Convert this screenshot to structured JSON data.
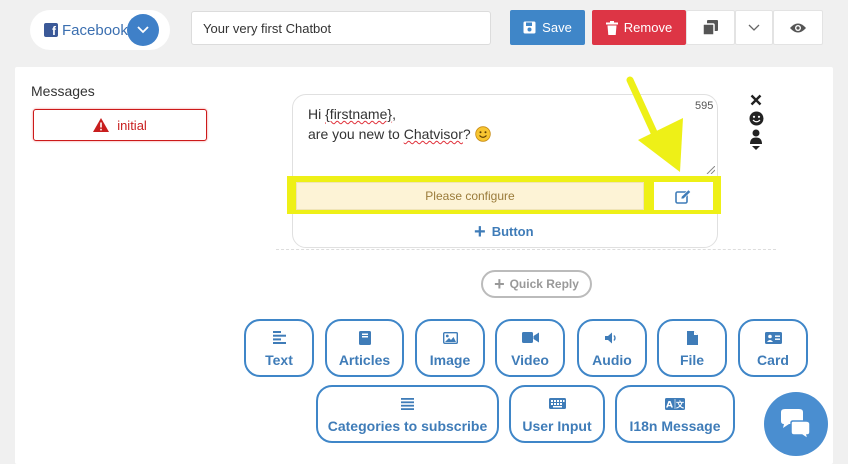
{
  "toolbar": {
    "platform_label": "Facebook",
    "title_value": "Your very first Chatbot",
    "save_label": "Save",
    "remove_label": "Remove"
  },
  "messages": {
    "heading": "Messages",
    "initial_label": "initial"
  },
  "message_card": {
    "line1_prefix": "Hi ",
    "line1_var": "{firstname}",
    "line1_suffix": ",",
    "line2_prefix": "are you new to ",
    "line2_brand": "Chatvisor",
    "line2_suffix": "? ",
    "char_counter": "595",
    "configure_label": "Please configure",
    "add_button_label": "Button"
  },
  "quick_reply_label": "Quick Reply",
  "types": {
    "text": "Text",
    "articles": "Articles",
    "image": "Image",
    "video": "Video",
    "audio": "Audio",
    "file": "File",
    "card": "Card",
    "categories": "Categories to subscribe",
    "user_input": "User Input",
    "i18n": "I18n Message"
  },
  "colors": {
    "primary": "#3f86c8",
    "danger": "#dd3545",
    "highlight": "#eef017"
  },
  "icons": [
    "facebook-icon",
    "chevron-down-icon",
    "save-icon",
    "trash-icon",
    "copy-icon",
    "eye-icon",
    "warning-icon",
    "close-icon",
    "emoji-icon",
    "person-icon",
    "edit-icon",
    "plus-icon",
    "text-icon",
    "book-icon",
    "image-icon",
    "video-icon",
    "audio-icon",
    "file-icon",
    "card-icon",
    "list-icon",
    "keyboard-icon",
    "translate-icon",
    "chat-icon"
  ]
}
